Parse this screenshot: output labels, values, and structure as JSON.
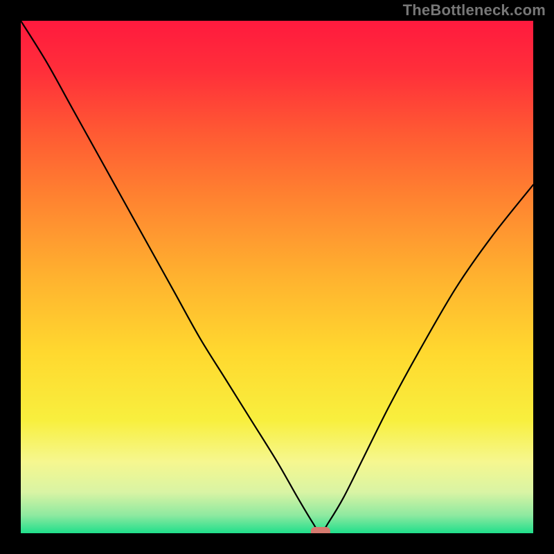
{
  "watermark": {
    "text": "TheBottleneck.com"
  },
  "gradient": {
    "stops": [
      {
        "offset": 0.0,
        "color": "#ff1a3e"
      },
      {
        "offset": 0.1,
        "color": "#ff2f3a"
      },
      {
        "offset": 0.22,
        "color": "#ff5a33"
      },
      {
        "offset": 0.35,
        "color": "#ff8430"
      },
      {
        "offset": 0.5,
        "color": "#ffb22f"
      },
      {
        "offset": 0.65,
        "color": "#ffd92f"
      },
      {
        "offset": 0.78,
        "color": "#f8ef3e"
      },
      {
        "offset": 0.86,
        "color": "#f6f78f"
      },
      {
        "offset": 0.92,
        "color": "#d9f4a4"
      },
      {
        "offset": 0.965,
        "color": "#8ee9a0"
      },
      {
        "offset": 1.0,
        "color": "#1fdf8b"
      }
    ]
  },
  "chart_data": {
    "type": "line",
    "title": "",
    "xlabel": "",
    "ylabel": "",
    "xlim": [
      0,
      100
    ],
    "ylim": [
      0,
      100
    ],
    "series": [
      {
        "name": "bottleneck-curve",
        "x": [
          0,
          5,
          10,
          15,
          20,
          25,
          30,
          35,
          40,
          45,
          50,
          54,
          57,
          58.5,
          60,
          63,
          67,
          72,
          78,
          85,
          92,
          100
        ],
        "y": [
          100,
          92,
          83,
          74,
          65,
          56,
          47,
          38,
          30,
          22,
          14,
          7,
          2,
          0,
          2,
          7,
          15,
          25,
          36,
          48,
          58,
          68
        ]
      }
    ],
    "annotations": [
      {
        "name": "min-marker",
        "x": 58.5,
        "y": 0,
        "shape": "rounded-rect",
        "color": "#d67a6f"
      }
    ]
  }
}
